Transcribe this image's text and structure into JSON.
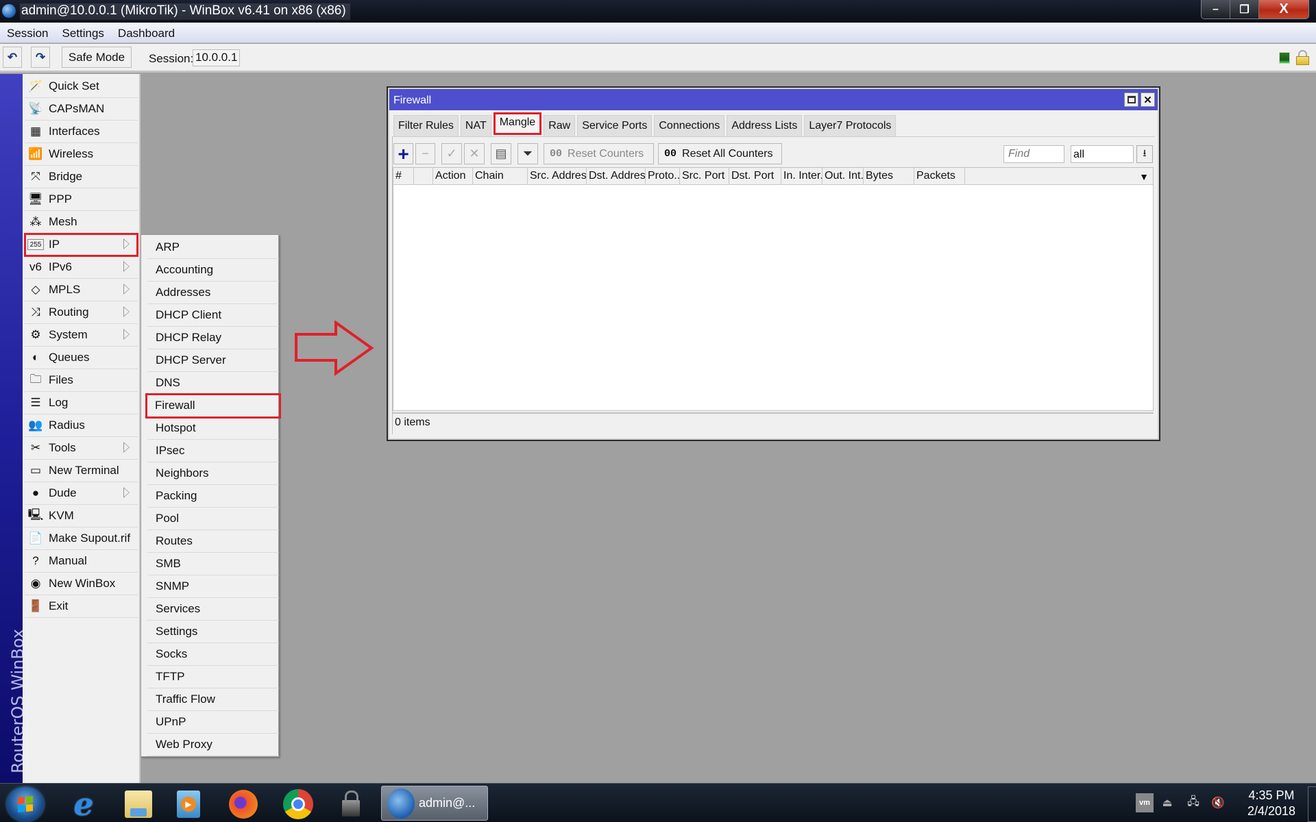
{
  "window": {
    "title": "admin@10.0.0.1 (MikroTik) - WinBox v6.41 on x86 (x86)",
    "controls": {
      "minimize": "–",
      "restore": "❐",
      "close": "X"
    }
  },
  "menubar": {
    "items": [
      "Session",
      "Settings",
      "Dashboard"
    ]
  },
  "toolbar": {
    "undo_icon": "↶",
    "redo_icon": "↷",
    "safe_mode_label": "Safe Mode",
    "session_label": "Session:",
    "session_value": "10.0.0.1"
  },
  "brand_vertical": "RouterOS WinBox",
  "sidebar": {
    "items": [
      {
        "label": "Quick Set",
        "icon": "🪄",
        "submenu": false
      },
      {
        "label": "CAPsMAN",
        "icon": "📡",
        "submenu": false
      },
      {
        "label": "Interfaces",
        "icon": "▦",
        "submenu": false
      },
      {
        "label": "Wireless",
        "icon": "📶",
        "submenu": false
      },
      {
        "label": "Bridge",
        "icon": "⤧",
        "submenu": false
      },
      {
        "label": "PPP",
        "icon": "🖥",
        "submenu": false
      },
      {
        "label": "Mesh",
        "icon": "⁂",
        "submenu": false
      },
      {
        "label": "IP",
        "icon": "255",
        "submenu": true,
        "selected": true
      },
      {
        "label": "IPv6",
        "icon": "v6",
        "submenu": true
      },
      {
        "label": "MPLS",
        "icon": "◇",
        "submenu": true
      },
      {
        "label": "Routing",
        "icon": "⤨",
        "submenu": true
      },
      {
        "label": "System",
        "icon": "⚙",
        "submenu": true
      },
      {
        "label": "Queues",
        "icon": "◐",
        "submenu": false
      },
      {
        "label": "Files",
        "icon": "🗀",
        "submenu": false
      },
      {
        "label": "Log",
        "icon": "☰",
        "submenu": false
      },
      {
        "label": "Radius",
        "icon": "👥",
        "submenu": false
      },
      {
        "label": "Tools",
        "icon": "✂",
        "submenu": true
      },
      {
        "label": "New Terminal",
        "icon": "▭",
        "submenu": false
      },
      {
        "label": "Dude",
        "icon": "●",
        "submenu": true
      },
      {
        "label": "KVM",
        "icon": "🖳",
        "submenu": false
      },
      {
        "label": "Make Supout.rif",
        "icon": "📄",
        "submenu": false
      },
      {
        "label": "Manual",
        "icon": "?",
        "submenu": false
      },
      {
        "label": "New WinBox",
        "icon": "◉",
        "submenu": false
      },
      {
        "label": "Exit",
        "icon": "🚪",
        "submenu": false
      }
    ]
  },
  "ip_submenu": {
    "items": [
      "ARP",
      "Accounting",
      "Addresses",
      "DHCP Client",
      "DHCP Relay",
      "DHCP Server",
      "DNS",
      "Firewall",
      "Hotspot",
      "IPsec",
      "Neighbors",
      "Packing",
      "Pool",
      "Routes",
      "SMB",
      "SNMP",
      "Services",
      "Settings",
      "Socks",
      "TFTP",
      "Traffic Flow",
      "UPnP",
      "Web Proxy"
    ],
    "selected": "Firewall"
  },
  "firewall": {
    "title": "Firewall",
    "tabs": [
      "Filter Rules",
      "NAT",
      "Mangle",
      "Raw",
      "Service Ports",
      "Connections",
      "Address Lists",
      "Layer7 Protocols"
    ],
    "active_tab": "Mangle",
    "buttons": {
      "add": "+",
      "remove": "−",
      "enable": "✓",
      "disable": "✕",
      "comment": "▤",
      "filter": "⏷",
      "reset_counters_prefix": "00",
      "reset_counters": "Reset Counters",
      "reset_all_prefix": "00",
      "reset_all_counters": "Reset All Counters"
    },
    "find_placeholder": "Find",
    "filter_select": "all",
    "columns": [
      "#",
      "",
      "Action",
      "Chain",
      "Src. Address",
      "Dst. Address",
      "Proto...",
      "Src. Port",
      "Dst. Port",
      "In. Inter...",
      "Out. Int...",
      "Bytes",
      "Packets",
      ""
    ],
    "rows": [],
    "status": "0 items"
  },
  "taskbar": {
    "apps": [
      "Start",
      "Internet Explorer",
      "File Explorer",
      "Media Player",
      "Firefox",
      "Chrome",
      "VPN"
    ],
    "active_task_label": "admin@...",
    "clock_time": "4:35 PM",
    "clock_date": "2/4/2018",
    "tray": {
      "vm": "vm",
      "usb": "⏏",
      "network": "🖧",
      "volume": "🔇"
    }
  },
  "colors": {
    "accent_window_title": "#4d4fcc",
    "highlight_red": "#e0202a",
    "sidebar_band": "#1f1f9a"
  }
}
